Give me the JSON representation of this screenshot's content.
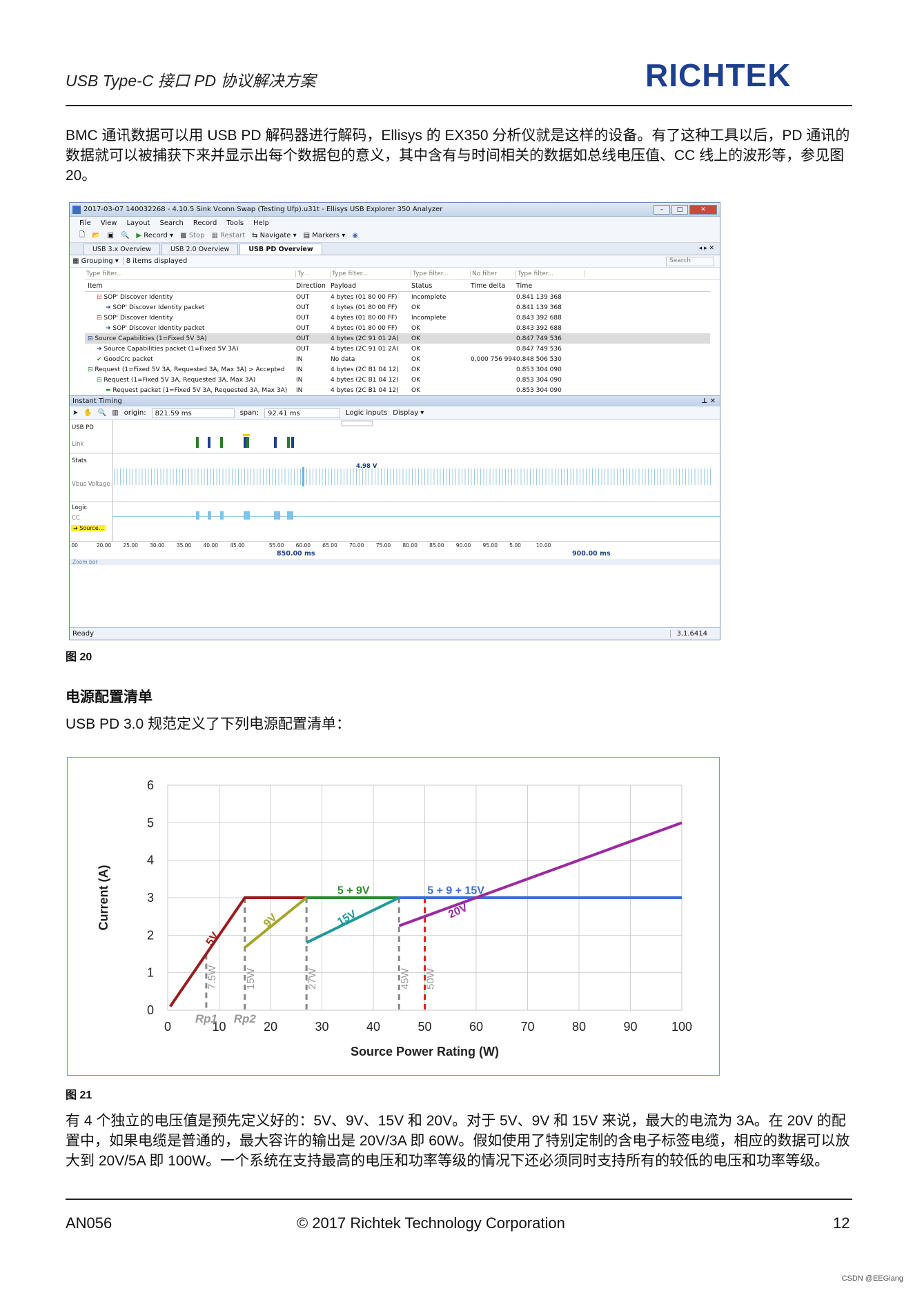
{
  "header": {
    "title": "USB Type-C 接口 PD 协议解决方案",
    "logo_text": "RICHTEK"
  },
  "intro_paragraph": "BMC 通讯数据可以用 USB PD 解码器进行解码，Ellisys 的 EX350 分析仪就是这样的设备。有了这种工具以后，PD 通讯的数据就可以被捕获下来并显示出每个数据包的意义，其中含有与时间相关的数据如总线电压值、CC 线上的波形等，参见图 20。",
  "analyzer": {
    "window_title": "2017-03-07 140032268 - 4.10.5 Sink Vconn Swap (Testing Ufp).u31t - Ellisys USB Explorer 350 Analyzer",
    "menu": [
      "File",
      "View",
      "Layout",
      "Search",
      "Record",
      "Tools",
      "Help"
    ],
    "toolbar": {
      "record": "Record",
      "stop": "Stop",
      "restart": "Restart",
      "navigate": "Navigate",
      "markers": "Markers"
    },
    "tabs": [
      "USB 3.x Overview",
      "USB 2.0 Overview",
      "USB PD Overview"
    ],
    "grouping_label": "Grouping",
    "items_displayed": "8 items displayed",
    "search_placeholder": "Search",
    "filters": [
      "Type filter...",
      "Ty...",
      "Type filter...",
      "Type filter...",
      "No filter",
      "Type filter..."
    ],
    "columns": [
      "Item",
      "Direction",
      "Payload",
      "Status",
      "Time delta",
      "Time"
    ],
    "rows": [
      {
        "item": "SOP' Discover Identity",
        "dir": "OUT",
        "payload": "4 bytes (01 80 00 FF)",
        "status": "Incomplete",
        "delta": "",
        "time": "0.841 139 368"
      },
      {
        "item": "SOP' Discover Identity packet",
        "dir": "OUT",
        "payload": "4 bytes (01 80 00 FF)",
        "status": "OK",
        "delta": "",
        "time": "0.841 139 368"
      },
      {
        "item": "SOP' Discover Identity",
        "dir": "OUT",
        "payload": "4 bytes (01 80 00 FF)",
        "status": "Incomplete",
        "delta": "",
        "time": "0.843 392 688"
      },
      {
        "item": "SOP' Discover Identity packet",
        "dir": "OUT",
        "payload": "4 bytes (01 80 00 FF)",
        "status": "OK",
        "delta": "",
        "time": "0.843 392 688"
      },
      {
        "item": "Source Capabilities (1=Fixed 5V 3A)",
        "dir": "OUT",
        "payload": "4 bytes (2C 91 01 2A)",
        "status": "OK",
        "delta": "",
        "time": "0.847 749 536"
      },
      {
        "item": "Source Capabilities packet (1=Fixed 5V 3A)",
        "dir": "OUT",
        "payload": "4 bytes (2C 91 01 2A)",
        "status": "OK",
        "delta": "",
        "time": "0.847 749 536"
      },
      {
        "item": "GoodCrc packet",
        "dir": "IN",
        "payload": "No data",
        "status": "OK",
        "delta": "0.000 756 994",
        "time": "0.848 506 530"
      },
      {
        "item": "Request (1=Fixed 5V 3A, Requested 3A, Max 3A) > Accepted",
        "dir": "IN",
        "payload": "4 bytes (2C B1 04 12)",
        "status": "OK",
        "delta": "",
        "time": "0.853 304 090"
      },
      {
        "item": "Request (1=Fixed 5V 3A, Requested 3A, Max 3A)",
        "dir": "IN",
        "payload": "4 bytes (2C B1 04 12)",
        "status": "OK",
        "delta": "",
        "time": "0.853 304 090"
      },
      {
        "item": "Request packet (1=Fixed 5V 3A, Requested 3A, Max 3A)",
        "dir": "IN",
        "payload": "4 bytes (2C B1 04 12)",
        "status": "OK",
        "delta": "",
        "time": "0.853 304 090"
      }
    ],
    "instant_timing": {
      "title": "Instant Timing",
      "origin_label": "origin:",
      "origin_value": "821.59 ms",
      "span_label": "span:",
      "span_value": "92.41 ms",
      "logic_inputs": "Logic inputs",
      "display": "Display",
      "lanes": [
        "USB PD",
        "Link",
        "Stats",
        "Vbus Voltage",
        "Logic",
        "CC"
      ],
      "source_marker": "Source...",
      "vbus_label": "4.98 V",
      "ticks": [
        ".00",
        "20.00",
        "25.00",
        "30.00",
        "35.00",
        "40.00",
        "45.00",
        "55.00",
        "60.00",
        "65.00",
        "70.00",
        "75.00",
        "80.00",
        "85.00",
        "90.00",
        "95.00",
        "5.00",
        "10.00"
      ],
      "major1": "850.00 ms",
      "major2": "900.00 ms",
      "zoom_bar": "Zoom bar"
    },
    "status": "Ready",
    "version": "3.1.6414"
  },
  "fig20_caption": "图 20",
  "section_title": "电源配置清单",
  "section_intro": "USB PD 3.0 规范定义了下列电源配置清单：",
  "chart_data": {
    "type": "line",
    "xlabel": "Source Power Rating (W)",
    "ylabel": "Current (A)",
    "xlim": [
      0,
      100
    ],
    "ylim": [
      0,
      6
    ],
    "x_ticks": [
      0,
      10,
      20,
      30,
      40,
      50,
      60,
      70,
      80,
      90,
      100
    ],
    "y_ticks": [
      0,
      1,
      2,
      3,
      4,
      5,
      6
    ],
    "grid": true,
    "series": [
      {
        "name": "5V",
        "color": "#9b1c1c",
        "points": [
          [
            0.5,
            0.1
          ],
          [
            15,
            3
          ],
          [
            27,
            3
          ]
        ]
      },
      {
        "name": "9V",
        "color": "#a5a52a",
        "points": [
          [
            15,
            1.67
          ],
          [
            27,
            3
          ]
        ]
      },
      {
        "name": "5 + 9V",
        "color": "#2e8b2e",
        "points": [
          [
            27,
            3
          ],
          [
            45,
            3
          ]
        ]
      },
      {
        "name": "15V",
        "color": "#1f9a9a",
        "points": [
          [
            27,
            1.8
          ],
          [
            45,
            3
          ]
        ]
      },
      {
        "name": "5 + 9 + 15V",
        "color": "#3b6fd8",
        "points": [
          [
            45,
            3
          ],
          [
            100,
            3
          ]
        ]
      },
      {
        "name": "20V",
        "color": "#9b2aa0",
        "points": [
          [
            45,
            2.25
          ],
          [
            100,
            5
          ]
        ]
      }
    ],
    "vlines": [
      {
        "x": 7.5,
        "label": "7.5W",
        "color": "#888888",
        "style": "dashed"
      },
      {
        "x": 15,
        "label": "15W",
        "color": "#888888",
        "style": "dashed"
      },
      {
        "x": 27,
        "label": "27W",
        "color": "#888888",
        "style": "dashed"
      },
      {
        "x": 45,
        "label": "45W",
        "color": "#888888",
        "style": "dashed"
      },
      {
        "x": 50,
        "label": "50W",
        "color": "#e02020",
        "style": "dashed"
      }
    ],
    "annotations": [
      "Rp1",
      "Rp2"
    ]
  },
  "fig21_caption": "图 21",
  "closing_paragraph": "有 4 个独立的电压值是预先定义好的：5V、9V、15V 和 20V。对于 5V、9V 和 15V 来说，最大的电流为 3A。在 20V 的配置中，如果电缆是普通的，最大容许的输出是 20V/3A 即 60W。假如使用了特别定制的含电子标签电缆，相应的数据可以放大到 20V/5A 即 100W。一个系统在支持最高的电压和功率等级的情况下还必须同时支持所有的较低的电压和功率等级。",
  "footer": {
    "left": "AN056",
    "center": "© 2017 Richtek Technology Corporation",
    "page": "12"
  },
  "watermark": "CSDN @EEGiang"
}
